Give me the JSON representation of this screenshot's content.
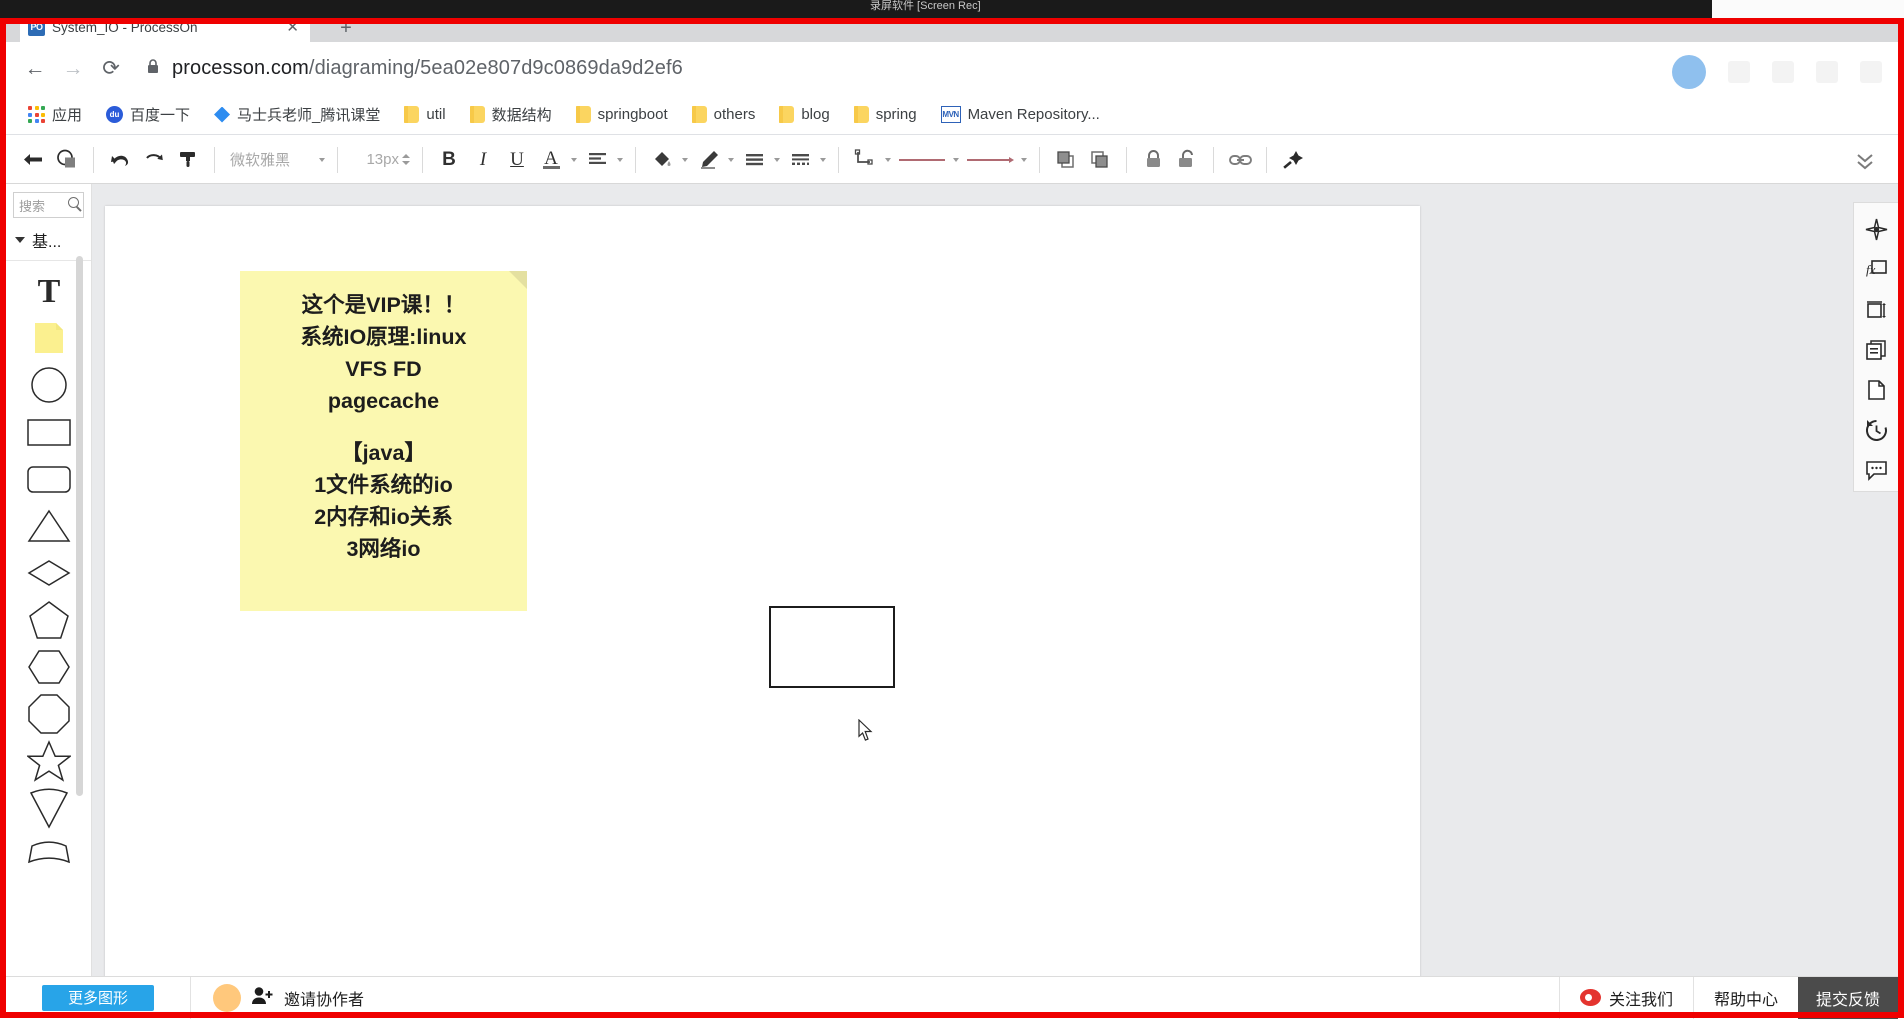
{
  "os": {
    "window_title": "录屏软件 [Screen Rec]"
  },
  "browser": {
    "tab": {
      "favicon_text": "PO",
      "title": "System_IO - ProcessOn",
      "close_label": "✕",
      "new_tab_label": "+"
    },
    "nav": {
      "back": "←",
      "forward": "→",
      "reload": "⟳"
    },
    "address": {
      "lock_icon": "lock-icon",
      "host": "processon.com",
      "path": "/diagraming/5ea02e807d9c0869da9d2ef6"
    },
    "bookmarks": [
      {
        "icon": "apps-grid-icon",
        "label": "应用"
      },
      {
        "icon": "baidu-icon",
        "label": "百度一下"
      },
      {
        "icon": "diamond-icon",
        "label": "马士兵老师_腾讯课堂"
      },
      {
        "icon": "folder-icon",
        "label": "util"
      },
      {
        "icon": "folder-icon",
        "label": "数据结构"
      },
      {
        "icon": "folder-icon",
        "label": "springboot"
      },
      {
        "icon": "folder-icon",
        "label": "others"
      },
      {
        "icon": "folder-icon",
        "label": "blog"
      },
      {
        "icon": "folder-icon",
        "label": "spring"
      },
      {
        "icon": "maven-icon",
        "label": "Maven Repository..."
      }
    ]
  },
  "toolbar": {
    "undo_arrow": "back-arrow-icon",
    "select_shape": "select-shape-icon",
    "undo": "undo-icon",
    "redo": "redo-icon",
    "format_painter": "format-painter-icon",
    "font_name": "微软雅黑",
    "font_size": "13px",
    "bold": "B",
    "italic": "I",
    "underline": "U",
    "font_color": "A",
    "align": "align-left-icon",
    "fill": "fill-bucket-icon",
    "line_color": "pen-icon",
    "line_style": "line-style-icon",
    "border_style": "border-style-icon",
    "connector": "connector-icon",
    "line_type_1": "solid-line-icon",
    "line_type_2": "arrow-line-icon",
    "bring_front": "bring-to-front-icon",
    "send_back": "send-to-back-icon",
    "lock": "lock-closed-icon",
    "unlock": "lock-open-icon",
    "link": "link-icon",
    "magic": "magic-wand-icon",
    "collapse": "chevron-double-down-icon"
  },
  "shapes_panel": {
    "search_placeholder": "搜索",
    "search_value": "",
    "category_label": "基...",
    "shapes": [
      {
        "name": "text-shape",
        "kind": "text"
      },
      {
        "name": "sticky-note-shape",
        "kind": "note"
      },
      {
        "name": "circle-shape",
        "kind": "circle"
      },
      {
        "name": "rectangle-shape",
        "kind": "rect"
      },
      {
        "name": "rounded-rectangle-shape",
        "kind": "roundrect"
      },
      {
        "name": "triangle-shape",
        "kind": "triangle"
      },
      {
        "name": "diamond-shape",
        "kind": "diamond"
      },
      {
        "name": "pentagon-shape",
        "kind": "pentagon"
      },
      {
        "name": "hexagon-shape",
        "kind": "hexagon"
      },
      {
        "name": "octagon-shape",
        "kind": "octagon"
      },
      {
        "name": "star-shape",
        "kind": "star"
      },
      {
        "name": "cone-shape",
        "kind": "cone"
      },
      {
        "name": "arc-shape",
        "kind": "arc"
      }
    ]
  },
  "canvas": {
    "sticky_note": {
      "line1": "这个是VIP课！！",
      "line2": "系统IO原理:linux",
      "line3": "VFS FD",
      "line4": "pagecache",
      "line5": "【java】",
      "line6": "1文件系统的io",
      "line7": "2内存和io关系",
      "line8": "3网络io",
      "fill_color": "#fbf8b0",
      "text_color": "#1d1d1d"
    },
    "rectangle": {
      "name": "empty-rectangle-shape",
      "stroke_color": "#1c1c1c",
      "fill_color": "#ffffff"
    }
  },
  "right_rail": [
    {
      "name": "navigator-icon",
      "label": "导航"
    },
    {
      "name": "formula-icon",
      "label": "fx"
    },
    {
      "name": "resize-icon",
      "label": "尺寸"
    },
    {
      "name": "layers-icon",
      "label": "图层"
    },
    {
      "name": "page-icon",
      "label": "页面"
    },
    {
      "name": "history-icon",
      "label": "历史"
    },
    {
      "name": "comment-icon",
      "label": "评论"
    }
  ],
  "bottom_bar": {
    "more_shapes": "更多图形",
    "invite": "邀请协作者",
    "follow_us": "关注我们",
    "help_center": "帮助中心",
    "feedback": "提交反馈"
  }
}
